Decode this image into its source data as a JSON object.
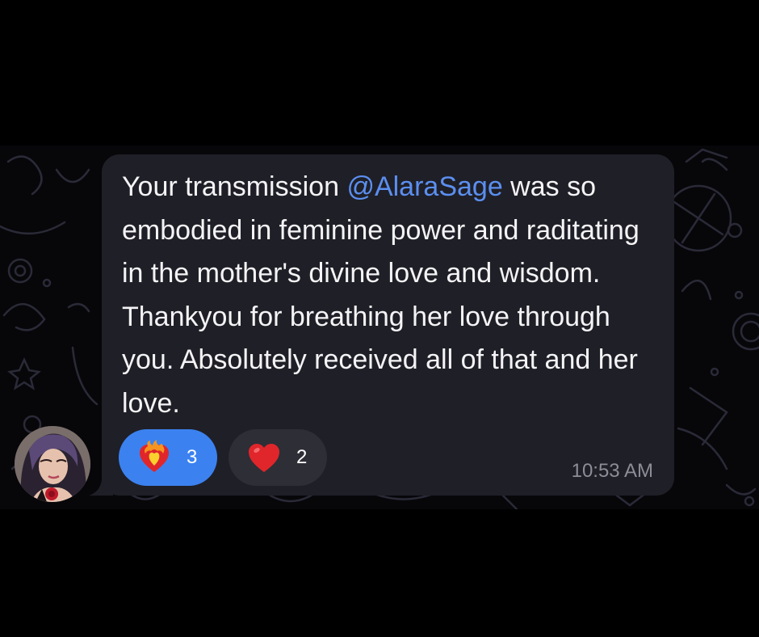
{
  "message": {
    "text_before_mention": "Your transmission ",
    "mention": "@AlaraSage",
    "text_after_mention": " was so embodied in feminine power and raditating in the mother's divine love and wisdom. Thankyou for breathing her love through you. Absolutely received all of that and her love.",
    "timestamp": "10:53 AM"
  },
  "reactions": [
    {
      "emoji": "heart-on-fire-icon",
      "count": "3",
      "selected": true
    },
    {
      "emoji": "red-heart-icon",
      "count": "2",
      "selected": false
    }
  ],
  "avatar": {
    "icon": "user-avatar"
  },
  "colors": {
    "bubble": "#1f1f27",
    "mention": "#5b8ff0",
    "reaction_selected": "#3b82f0",
    "reaction_default": "#2e2e36",
    "timestamp": "#8d8d98"
  }
}
